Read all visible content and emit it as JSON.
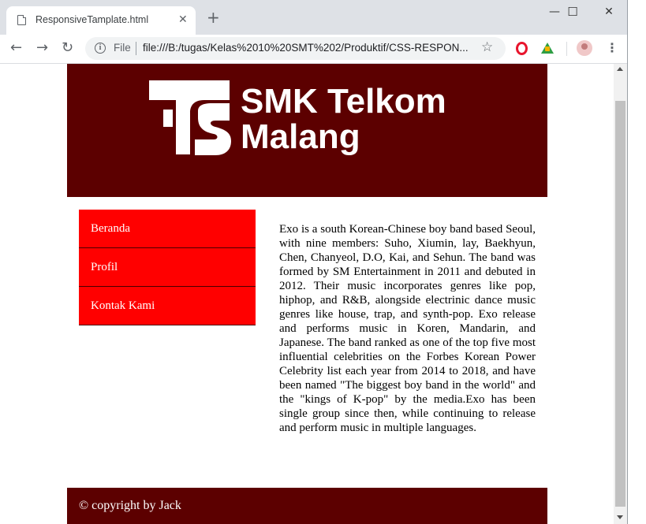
{
  "browser": {
    "tab_title": "ResponsiveTamplate.html",
    "tab_close": "✕",
    "new_tab": "+",
    "window_controls": {
      "minimize": "—",
      "maximize": "☐",
      "close": "✕"
    },
    "nav": {
      "back": "←",
      "forward": "→",
      "reload": "↻"
    },
    "omnibox": {
      "info_glyph": "i",
      "scheme_label": "File",
      "url": "file:///B:/tugas/Kelas%2010%20SMT%202/Produktif/CSS-RESPON..."
    },
    "bookmark_star": "☆",
    "menu_dots": "⋮"
  },
  "page": {
    "header": {
      "brand_line1": "SMK Telkom",
      "brand_line2": "Malang",
      "bg_color": "#5c0000"
    },
    "nav_items": [
      {
        "label": "Beranda"
      },
      {
        "label": "Profil"
      },
      {
        "label": "Kontak Kami"
      }
    ],
    "nav_color": "#ff0000",
    "article": {
      "text": "Exo is a south Korean-Chinese boy band based Seoul, with nine members: Suho, Xiumin, lay, Baekhyun, Chen, Chanyeol, D.O, Kai, and Sehun. The band was formed by SM Entertainment in 2011 and debuted in 2012. Their music incorporates genres like pop, hiphop, and R&B, alongside electrinic dance music genres like house, trap, and synth-pop. Exo release and performs music in Koren, Mandarin, and Japanese. The band ranked as one of the top five most influential celebrities on the Forbes Korean Power Celebrity list each year from 2014 to 2018, and have been named \"The biggest boy band in the world\" and the \"kings of K-pop\" by the media.Exo has been single group since then, while continuing to release and perform music in multiple languages."
    },
    "footer": {
      "copyright": "© copyright by Jack"
    }
  }
}
